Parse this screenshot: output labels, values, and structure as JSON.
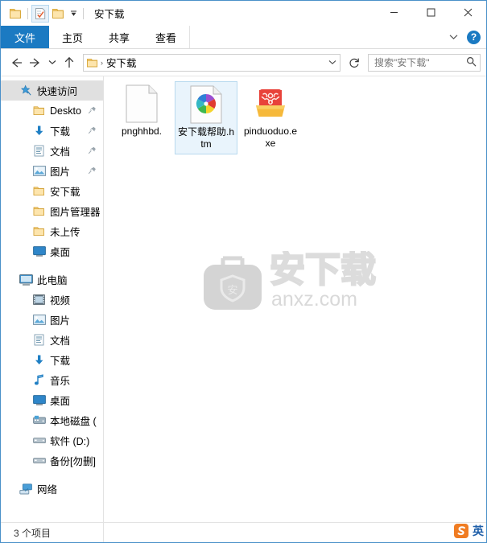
{
  "window": {
    "title": "安下载",
    "quick_access_toolbar": [
      {
        "name": "folder-icon",
        "label": ""
      },
      {
        "name": "properties-icon",
        "label": ""
      },
      {
        "name": "new-folder-icon",
        "label": ""
      },
      {
        "name": "customize-caret-icon",
        "label": ""
      }
    ],
    "controls": {
      "minimize": "—",
      "maximize": "▢",
      "close": "✕"
    }
  },
  "ribbon": {
    "tabs": [
      {
        "label": "文件",
        "active": true
      },
      {
        "label": "主页",
        "active": false
      },
      {
        "label": "共享",
        "active": false
      },
      {
        "label": "查看",
        "active": false
      }
    ],
    "expand_icon": "chevron-down-icon",
    "help_label": "?"
  },
  "navigation": {
    "back": "←",
    "forward": "→",
    "recent": "⌄",
    "up": "↑",
    "breadcrumb": {
      "separator": "›",
      "path": "安下载"
    },
    "address_caret": "⌄",
    "refresh": "↻"
  },
  "search": {
    "placeholder": "搜索\"安下载\"",
    "icon": "search-icon"
  },
  "sidebar": {
    "groups": [
      {
        "header": {
          "label": "快速访问",
          "icon": "star-pin-icon",
          "selected": true
        },
        "items": [
          {
            "label": "Deskto",
            "icon": "folder-icon",
            "pinned": true
          },
          {
            "label": "下载",
            "icon": "download-arrow-icon",
            "pinned": true
          },
          {
            "label": "文档",
            "icon": "documents-icon",
            "pinned": true
          },
          {
            "label": "图片",
            "icon": "pictures-icon",
            "pinned": true
          },
          {
            "label": "安下载",
            "icon": "folder-icon",
            "pinned": false
          },
          {
            "label": "图片管理器",
            "icon": "folder-icon",
            "pinned": false
          },
          {
            "label": "未上传",
            "icon": "folder-icon",
            "pinned": false
          },
          {
            "label": "桌面",
            "icon": "desktop-icon",
            "pinned": false
          }
        ]
      },
      {
        "header": {
          "label": "此电脑",
          "icon": "this-pc-icon",
          "selected": false
        },
        "items": [
          {
            "label": "视频",
            "icon": "videos-icon",
            "pinned": false
          },
          {
            "label": "图片",
            "icon": "pictures-icon",
            "pinned": false
          },
          {
            "label": "文档",
            "icon": "documents-icon",
            "pinned": false
          },
          {
            "label": "下载",
            "icon": "download-arrow-icon",
            "pinned": false
          },
          {
            "label": "音乐",
            "icon": "music-note-icon",
            "pinned": false
          },
          {
            "label": "桌面",
            "icon": "desktop-icon",
            "pinned": false
          },
          {
            "label": "本地磁盘 (",
            "icon": "local-disk-icon",
            "pinned": false
          },
          {
            "label": "软件 (D:)",
            "icon": "drive-icon",
            "pinned": false
          },
          {
            "label": "备份[勿删]",
            "icon": "drive-icon",
            "pinned": false
          }
        ]
      },
      {
        "header": {
          "label": "网络",
          "icon": "network-icon",
          "selected": false
        },
        "items": []
      }
    ]
  },
  "files": [
    {
      "name": "pnghhbd.",
      "icon": "blank-document-icon",
      "selected": false
    },
    {
      "name": "安下载帮助.htm",
      "icon": "html-pinwheel-icon",
      "selected": true
    },
    {
      "name": "pinduoduo.exe",
      "icon": "pinduoduo-app-icon",
      "selected": false
    }
  ],
  "watermark": {
    "logo": "anxz-bag-shield-logo",
    "brand": "安下载",
    "domain": "anxz.com"
  },
  "statusbar": {
    "item_count": "3 个项目"
  },
  "ime": {
    "logo": "sogou-logo",
    "mode": "英"
  },
  "colors": {
    "accent": "#1b7ac2",
    "selection": "#e9f4fc",
    "selection_border": "#b8d9ee",
    "window_border": "#4a90c9",
    "folder_yellow": "#fcd88a"
  }
}
